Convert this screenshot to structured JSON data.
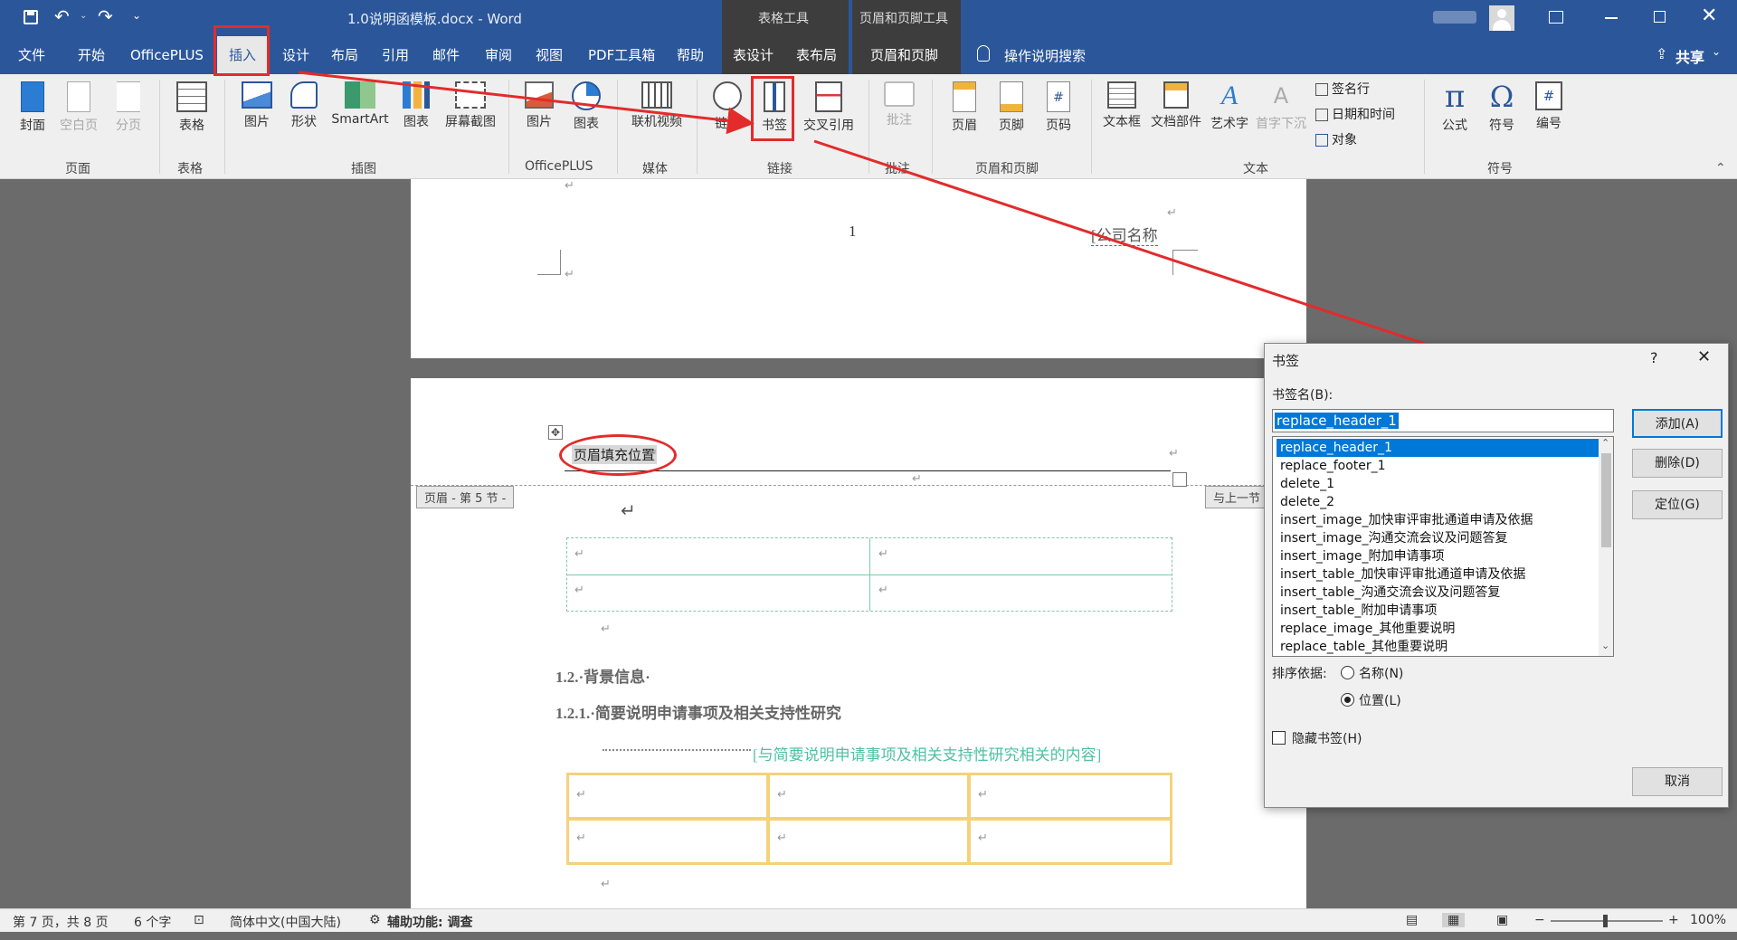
{
  "app": {
    "title": "1.0说明函模板.docx - Word",
    "context_tabs": [
      "表格工具",
      "页眉和页脚工具"
    ],
    "share_label": "共享"
  },
  "tabs": [
    "文件",
    "开始",
    "OfficePLUS",
    "插入",
    "设计",
    "布局",
    "引用",
    "邮件",
    "审阅",
    "视图",
    "PDF工具箱",
    "帮助",
    "表设计",
    "表布局",
    "页眉和页脚"
  ],
  "active_tab": "插入",
  "search_hint": "操作说明搜索",
  "ribbon": {
    "groups": {
      "page": {
        "label": "页面",
        "buttons": [
          "封面",
          "空白页",
          "分页"
        ]
      },
      "table": {
        "label": "表格",
        "buttons": [
          "表格"
        ]
      },
      "illustrations": {
        "label": "插图",
        "buttons": [
          "图片",
          "形状",
          "SmartArt",
          "图表",
          "屏幕截图"
        ]
      },
      "officeplus": {
        "label": "OfficePLUS",
        "buttons": [
          "图片",
          "图表"
        ]
      },
      "media": {
        "label": "媒体",
        "buttons": [
          "联机视频"
        ]
      },
      "links": {
        "label": "链接",
        "buttons": [
          "链接",
          "书签",
          "交叉引用"
        ]
      },
      "comments": {
        "label": "批注",
        "buttons": [
          "批注"
        ]
      },
      "header_footer": {
        "label": "页眉和页脚",
        "buttons": [
          "页眉",
          "页脚",
          "页码"
        ]
      },
      "text": {
        "label": "文本",
        "buttons": [
          "文本框",
          "文档部件",
          "艺术字",
          "首字下沉"
        ],
        "small": [
          "签名行",
          "日期和时间",
          "对象"
        ]
      },
      "symbols": {
        "label": "符号",
        "buttons": [
          "公式",
          "符号",
          "编号"
        ]
      }
    }
  },
  "document": {
    "page_number": "1",
    "company_placeholder": "[公司名称",
    "header_text": "页眉填充位置",
    "header_section_tag": "页眉 - 第 5 节 -",
    "link_prev_tag": "与上一节",
    "heading1": "1.2.·背景信息·",
    "heading2": "1.2.1.·简要说明申请事项及相关支持性研究",
    "body_text": "[与简要说明申请事项及相关支持性研究相关的内容]",
    "return_mark": "↵"
  },
  "dialog": {
    "title": "书签",
    "help": "?",
    "name_label": "书签名(B):",
    "name_value": "replace_header_1",
    "items": [
      "replace_header_1",
      "replace_footer_1",
      "delete_1",
      "delete_2",
      "insert_image_加快审评审批通道申请及依据",
      "insert_image_沟通交流会议及问题答复",
      "insert_image_附加申请事项",
      "insert_table_加快审评审批通道申请及依据",
      "insert_table_沟通交流会议及问题答复",
      "insert_table_附加申请事项",
      "replace_image_其他重要说明",
      "replace_table_其他重要说明"
    ],
    "selected_index": 0,
    "sort_label": "排序依据:",
    "sort_options": [
      "名称(N)",
      "位置(L)"
    ],
    "sort_selected": "位置(L)",
    "hide_label": "隐藏书签(H)",
    "buttons": {
      "add": "添加(A)",
      "delete": "删除(D)",
      "goto": "定位(G)",
      "cancel": "取消"
    }
  },
  "status": {
    "page": "第 7 页，共 8 页",
    "words": "6 个字",
    "language": "简体中文(中国大陆)",
    "accessibility": "辅助功能: 调查",
    "zoom": "100%"
  },
  "colors": {
    "brand": "#2b579a",
    "annotation": "#e32b2b",
    "accent_text": "#4fc1a3",
    "table_gold": "#f5d27a"
  }
}
